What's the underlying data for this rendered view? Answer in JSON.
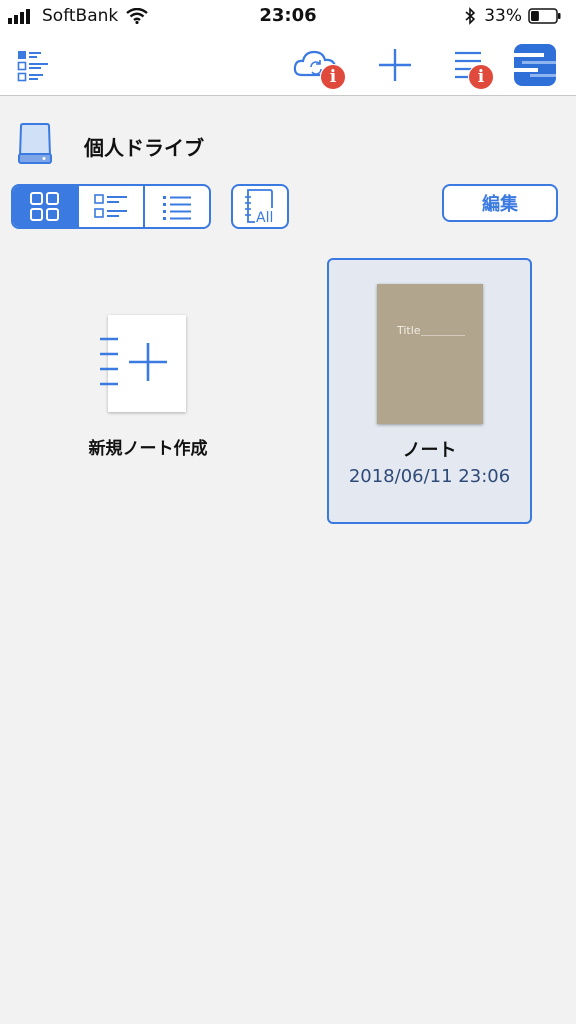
{
  "status": {
    "carrier": "SoftBank",
    "time": "23:06",
    "battery_percent": "33%",
    "battery_level": 0.33
  },
  "nav": {
    "badge_sync": "i",
    "badge_list": "i"
  },
  "drive": {
    "title": "個人ドライブ"
  },
  "toolbar": {
    "all_label": "All",
    "edit_label": "編集"
  },
  "items": {
    "new_note_label": "新規ノート作成",
    "note": {
      "cover_title": "Title",
      "name": "ノート",
      "date": "2018/06/11 23:06"
    }
  },
  "colors": {
    "accent": "#3b7ae0",
    "badge": "#e04a3c",
    "cover": "#b2a58e",
    "selected_bg": "#e4e9f1"
  }
}
